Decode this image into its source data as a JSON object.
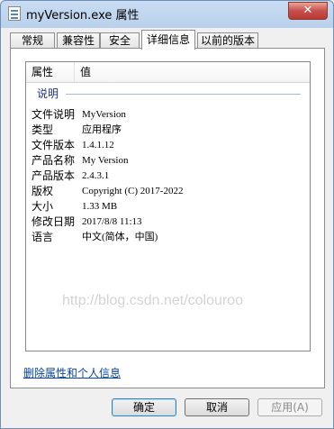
{
  "window": {
    "title": "myVersion.exe 属性",
    "close_label": "✕"
  },
  "tabs": [
    {
      "label": "常规",
      "active": false
    },
    {
      "label": "兼容性",
      "active": false
    },
    {
      "label": "安全",
      "active": false
    },
    {
      "label": "详细信息",
      "active": true
    },
    {
      "label": "以前的版本",
      "active": false
    }
  ],
  "details": {
    "columns": [
      "属性",
      "值"
    ],
    "group_label": "说明",
    "rows": [
      {
        "key": "文件说明",
        "value": "MyVersion"
      },
      {
        "key": "类型",
        "value": "应用程序"
      },
      {
        "key": "文件版本",
        "value": "1.4.1.12"
      },
      {
        "key": "产品名称",
        "value": "My Version"
      },
      {
        "key": "产品版本",
        "value": "2.4.3.1"
      },
      {
        "key": "版权",
        "value": "Copyright (C) 2017-2022"
      },
      {
        "key": "大小",
        "value": "1.33 MB"
      },
      {
        "key": "修改日期",
        "value": "2017/8/8 11:13"
      },
      {
        "key": "语言",
        "value": "中文(简体，中国)"
      }
    ],
    "watermark": "http://blog.csdn.net/colouroo"
  },
  "links": {
    "remove_properties": "删除属性和个人信息"
  },
  "buttons": {
    "ok": "确定",
    "cancel": "取消",
    "apply": "应用(A)"
  }
}
